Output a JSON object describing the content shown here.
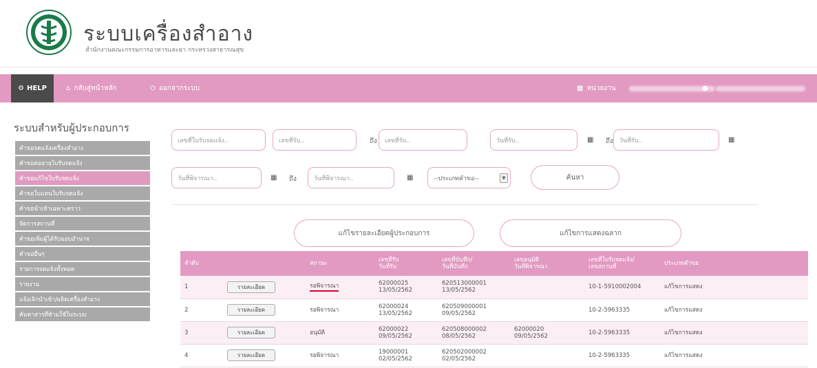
{
  "header": {
    "title": "ระบบเครื่องสำอาง",
    "subtitle": "สำนักงานคณะกรรมการอาหารและยา กระทรวงสาธารณสุข"
  },
  "topnav": {
    "help": "HELP",
    "home": "กลับสู่หน้าหลัก",
    "logout": "ออกจากระบบ",
    "agency": "หน่วยงาน"
  },
  "sidebar": {
    "title": "ระบบสำหรับผู้ประกอบการ",
    "items": [
      {
        "label": "คำขอจดแจ้งเครื่องสำอาง",
        "active": false
      },
      {
        "label": "คำขอต่ออายุใบรับจดแจ้ง",
        "active": false
      },
      {
        "label": "คำขอแก้ไขใบรับจดแจ้ง",
        "active": true
      },
      {
        "label": "คำขอใบแทนใบรับจดแจ้ง",
        "active": false
      },
      {
        "label": "คำขอนำเข้าเฉพาะคราว",
        "active": false
      },
      {
        "label": "จัดการสถานที่",
        "active": false
      },
      {
        "label": "คำขอเพิ่มผู้ได้รับมอบอำนาจ",
        "active": false
      },
      {
        "label": "คำขออื่นๆ",
        "active": false
      },
      {
        "label": "รายการจดแจ้งทั้งหมด",
        "active": false
      },
      {
        "label": "รายงาน",
        "active": false
      },
      {
        "label": "แจ้งเลิกนำเข้า/ผลิตเครื่องสำอาง",
        "active": false
      },
      {
        "label": "ค้นหาสารที่ห้ามใช้ในระบบ",
        "active": false
      }
    ]
  },
  "search": {
    "receipt_no_placeholder": "เลขที่ใบรับจดแจ้ง..",
    "recv_from_placeholder": "เลขที่รับ..",
    "to_label": "ถึง",
    "recv_to_placeholder": "เลขที่รับ..",
    "date_from_placeholder": "วันที่รับ..",
    "date_to_placeholder": "วันที่รับ..",
    "consider_from_placeholder": "วันที่พิจารณา..",
    "consider_to_placeholder": "วันที่พิจารณา..",
    "type_select": "--ประเภทคำขอ--",
    "search_button": "ค้นหา"
  },
  "actions": {
    "edit_operator": "แก้ไขรายละเอียดผู้ประกอบการ",
    "edit_label": "แก้ไขการแสดงฉลาก"
  },
  "table": {
    "headers": [
      "ลำดับ",
      "",
      "สถานะ",
      "เลขที่รับ\nวันที่รับ",
      "เลขที่บันทึก/\nวันที่บันทึก",
      "เลขอนุมัติ\nวันที่พิจารณา",
      "เลขที่ใบรับจดแจ้ง/\nเลขสถานที่",
      "ประเภทคำขอ"
    ],
    "rows": [
      {
        "no": "1",
        "detail": "รายละเอียด",
        "status": "รอพิจารณา",
        "recv_no": "62000025",
        "recv_date": "13/05/2562",
        "save_no": "620513000001",
        "save_date": "13/05/2562",
        "approve_no": "",
        "approve_date": "",
        "receipt_no": "10-1-5910002004",
        "type": "แก้ไขการแสดง"
      },
      {
        "no": "2",
        "detail": "รายละเอียด",
        "status": "รอพิจารณา",
        "recv_no": "62000024",
        "recv_date": "13/05/2562",
        "save_no": "620509000001",
        "save_date": "09/05/2562",
        "approve_no": "",
        "approve_date": "",
        "receipt_no": "10-2-5963335",
        "type": "แก้ไขการแสดง"
      },
      {
        "no": "3",
        "detail": "รายละเอียด",
        "status": "อนุมัติ",
        "recv_no": "62000022",
        "recv_date": "09/05/2562",
        "save_no": "620508000002",
        "save_date": "08/05/2562",
        "approve_no": "62000020",
        "approve_date": "09/05/2562",
        "receipt_no": "10-2-5963335",
        "type": "แก้ไขการแสดง"
      },
      {
        "no": "4",
        "detail": "รายละเอียด",
        "status": "รอพิจารณา",
        "recv_no": "19000001",
        "recv_date": "02/05/2562",
        "save_no": "620502000002",
        "save_date": "02/05/2562",
        "approve_no": "",
        "approve_date": "",
        "receipt_no": "10-2-5963335",
        "type": "แก้ไขการแสดง"
      }
    ]
  },
  "colors": {
    "pink": "#e29ac2",
    "pink_light": "#fbeef5",
    "sidebar_gray": "#a9a9a9",
    "logo_green": "#1a7a4a"
  }
}
